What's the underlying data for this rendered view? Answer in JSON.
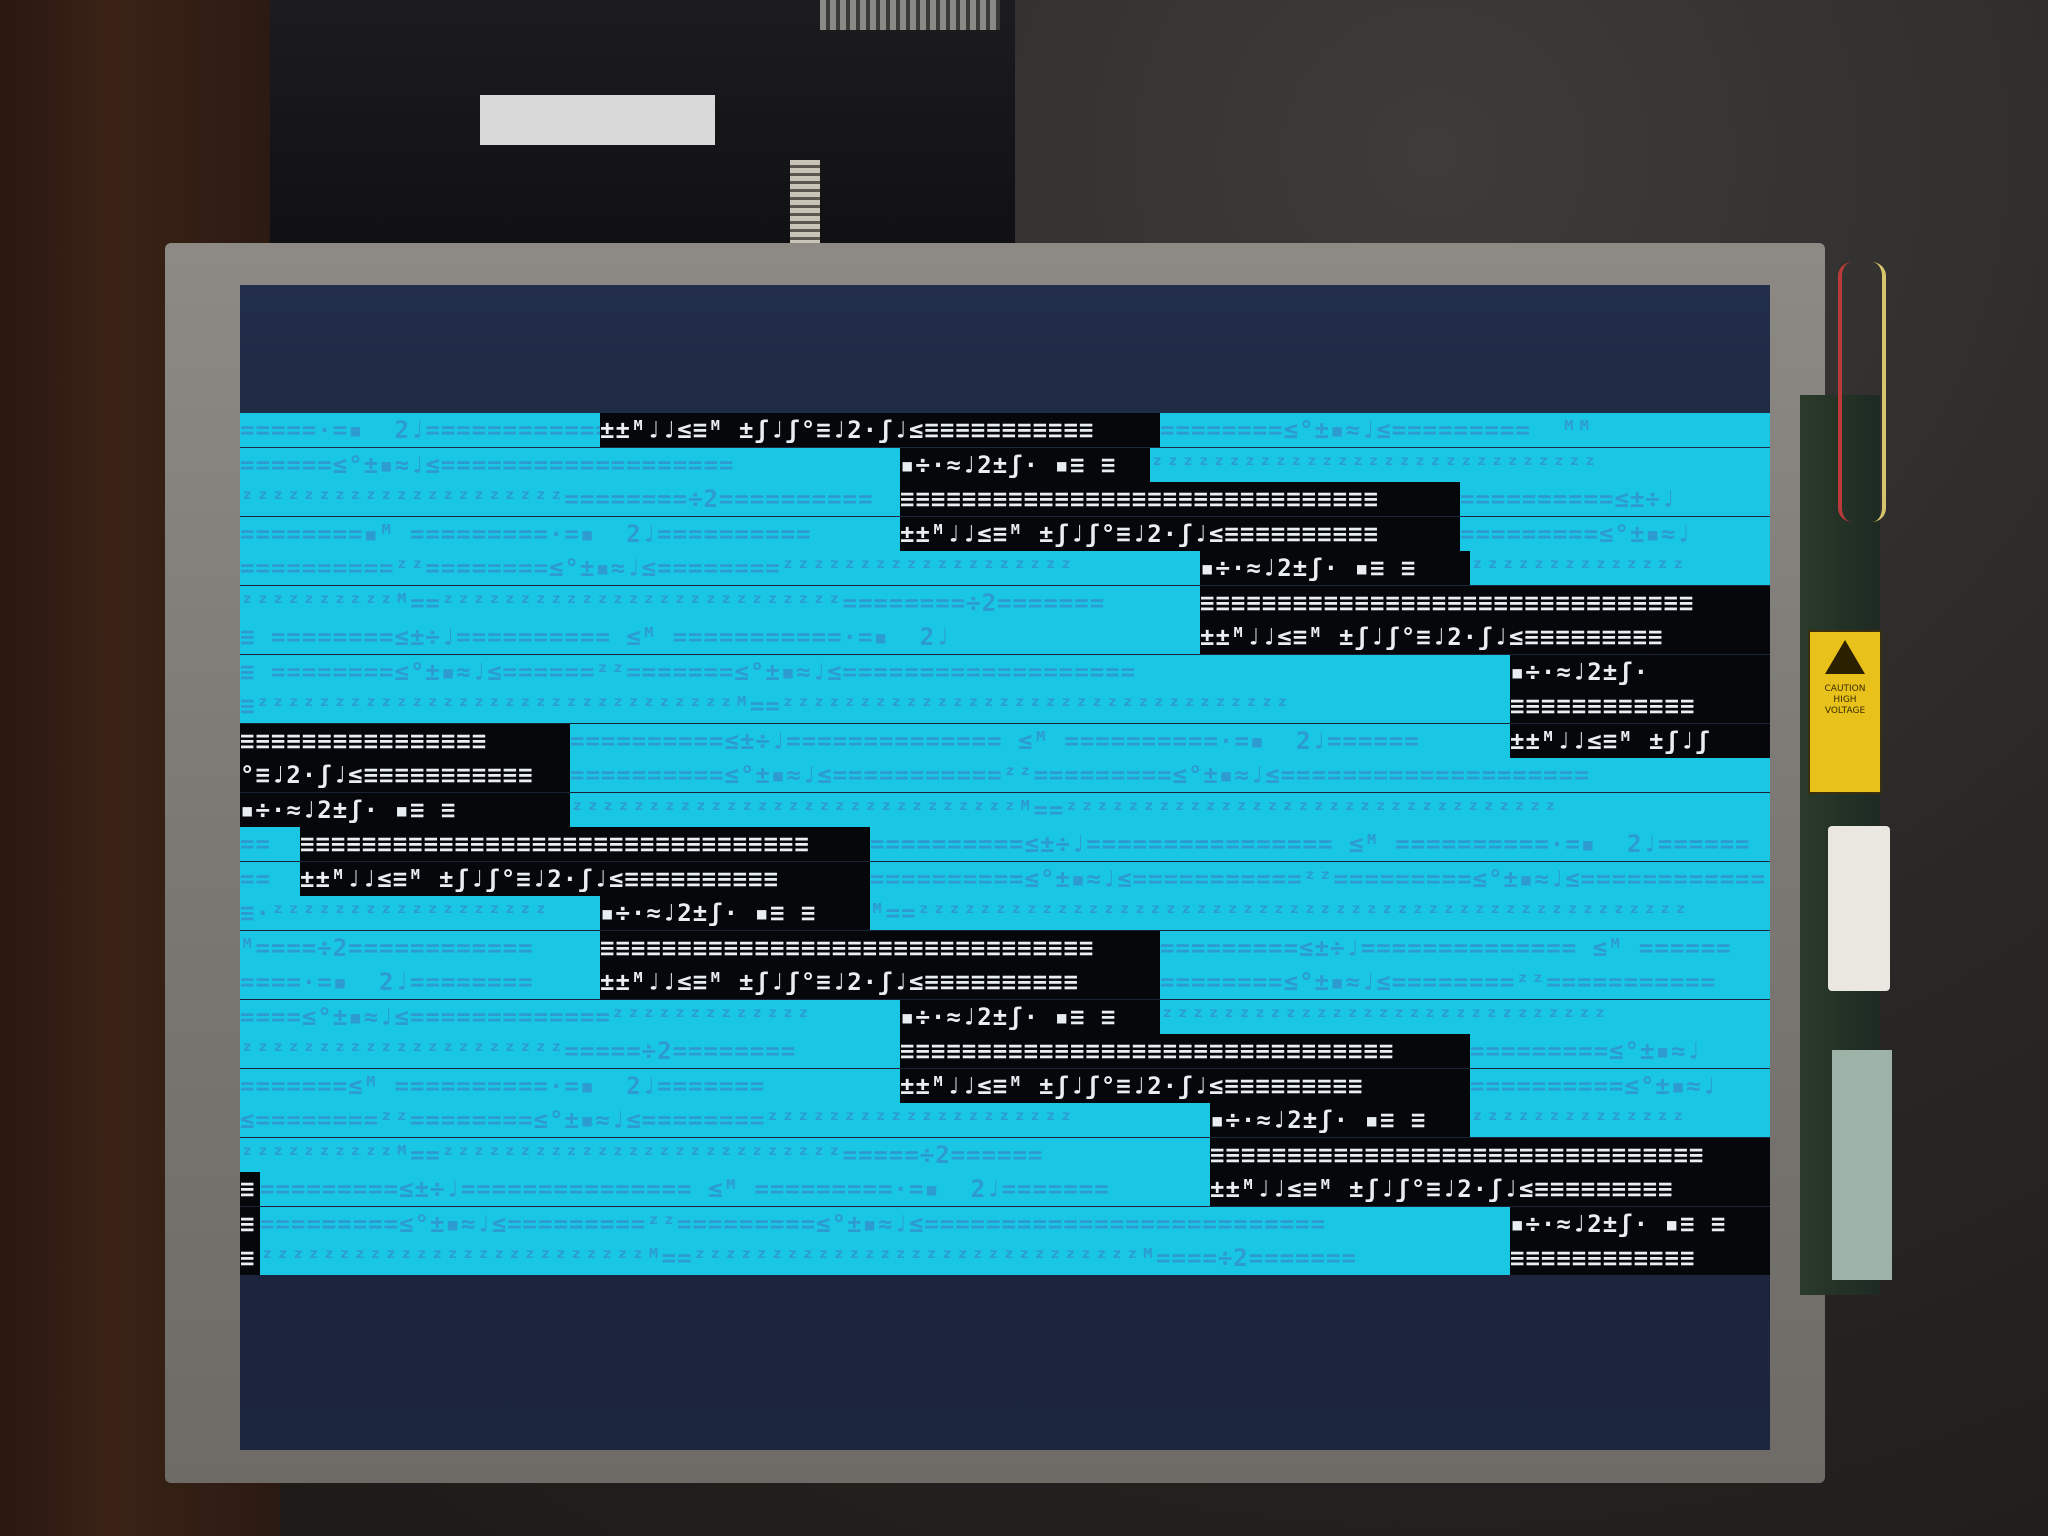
{
  "scene": {
    "colors": {
      "screen_off": "#1a2336",
      "cyan": "#19c6e4",
      "cyan_text": "#2d9ad0",
      "black_band": "#05070b",
      "black_text": "#e9eef2",
      "bezel": "#7b7873",
      "warning_label": "#e8c21a"
    },
    "warning_label": {
      "icon": "high-voltage-icon",
      "line1": "CAUTION",
      "line2": "HIGH",
      "line3": "VOLTAGE"
    }
  },
  "garbage_rows": [
    {
      "segs": [
        {
          "c": "cy",
          "w": 360,
          "t": "=====·=▪  2♩=================="
        },
        {
          "c": "bk",
          "w": 560,
          "t": "±±ᴹ♩♩≤≡ᴹ ±ʃ♩ʃ°≡♩2·ʃ♩≤≡≡≡≡≡≡≡≡≡≡≡"
        },
        {
          "c": "cy",
          "w": 610,
          "t": "========≤°±▪≈♩≤=========  ᴹᴹ"
        }
      ]
    },
    {
      "segs": [
        {
          "c": "cy",
          "w": 660,
          "t": "======≤°±▪≈♩≤==================="
        },
        {
          "c": "bk",
          "w": 250,
          "t": "▪÷·≈♩2±ʃ· ▪≡ ≡"
        },
        {
          "c": "cy",
          "w": 620,
          "t": "ᶻᶻᶻᶻᶻᶻᶻᶻᶻᶻᶻᶻᶻᶻᶻᶻᶻᶻᶻᶻᶻᶻᶻᶻᶻᶻᶻᶻᶻ"
        }
      ]
    },
    {
      "segs": [
        {
          "c": "cy",
          "w": 660,
          "t": "ᶻᶻᶻᶻᶻᶻᶻᶻᶻᶻᶻᶻᶻᶻᶻᶻᶻᶻᶻᶻᶻ========÷2=========="
        },
        {
          "c": "bk",
          "w": 560,
          "t": "≡≡≡≡≡≡≡≡≡≡≡≡≡≡≡≡≡≡≡≡≡≡≡≡≡≡≡≡≡≡≡"
        },
        {
          "c": "cy",
          "w": 310,
          "t": "==========≤±÷♩"
        }
      ]
    },
    {
      "segs": [
        {
          "c": "cy",
          "w": 660,
          "t": "========▪ᴹ =========·=▪  2♩=========="
        },
        {
          "c": "bk",
          "w": 560,
          "t": "±±ᴹ♩♩≤≡ᴹ ±ʃ♩ʃ°≡♩2·ʃ♩≤≡≡≡≡≡≡≡≡≡≡"
        },
        {
          "c": "cy",
          "w": 310,
          "t": "=========≤°±▪≈♩"
        }
      ]
    },
    {
      "segs": [
        {
          "c": "cy",
          "w": 960,
          "t": "==========ᶻᶻ========≤°±▪≈♩≤========ᶻᶻᶻᶻᶻᶻᶻᶻᶻᶻᶻᶻᶻᶻᶻᶻᶻᶻᶻ"
        },
        {
          "c": "bk",
          "w": 270,
          "t": "▪÷·≈♩2±ʃ· ▪≡ ≡"
        },
        {
          "c": "cy",
          "w": 300,
          "t": "ᶻᶻᶻᶻᶻᶻᶻᶻᶻᶻᶻᶻᶻᶻ"
        }
      ]
    },
    {
      "segs": [
        {
          "c": "cy",
          "w": 960,
          "t": "ᶻᶻᶻᶻᶻᶻᶻᶻᶻᶻᴹ==ᶻᶻᶻᶻᶻᶻᶻᶻᶻᶻᶻᶻᶻᶻᶻᶻᶻᶻᶻᶻᶻᶻᶻᶻᶻᶻ========÷2======="
        },
        {
          "c": "bk",
          "w": 570,
          "t": "≡≡≡≡≡≡≡≡≡≡≡≡≡≡≡≡≡≡≡≡≡≡≡≡≡≡≡≡≡≡≡≡"
        }
      ]
    },
    {
      "segs": [
        {
          "c": "cy",
          "w": 960,
          "t": "≡ ========≤±÷♩========== ≤ᴹ ===========·=▪  2♩"
        },
        {
          "c": "bk",
          "w": 570,
          "t": "±±ᴹ♩♩≤≡ᴹ ±ʃ♩ʃ°≡♩2·ʃ♩≤≡≡≡≡≡≡≡≡≡"
        }
      ]
    },
    {
      "segs": [
        {
          "c": "cy",
          "w": 1270,
          "t": "≡ ========≤°±▪≈♩≤======ᶻᶻ=======≤°±▪≈♩≤==================="
        },
        {
          "c": "bk",
          "w": 260,
          "t": "▪÷·≈♩2±ʃ·"
        }
      ]
    },
    {
      "segs": [
        {
          "c": "cy",
          "w": 1270,
          "t": "≡ᶻᶻᶻᶻᶻᶻᶻᶻᶻᶻᶻᶻᶻᶻᶻᶻᶻᶻᶻᶻᶻᶻᶻᶻᶻᶻᶻᶻᶻᶻᶻᴹ==ᶻᶻᶻᶻᶻᶻᶻᶻᶻᶻᶻᶻᶻᶻᶻᶻᶻᶻᶻᶻᶻᶻᶻᶻᶻᶻᶻᶻᶻᶻᶻᶻᶻ"
        },
        {
          "c": "bk",
          "w": 260,
          "t": "≡≡≡≡≡≡≡≡≡≡≡≡"
        }
      ]
    },
    {
      "segs": [
        {
          "c": "bk",
          "w": 330,
          "t": "≡≡≡≡≡≡≡≡≡≡≡≡≡≡≡≡"
        },
        {
          "c": "cy",
          "w": 940,
          "t": "==========≤±÷♩============== ≤ᴹ ==========·=▪  2♩======"
        },
        {
          "c": "bk",
          "w": 260,
          "t": "±±ᴹ♩♩≤≡ᴹ ±ʃ♩ʃ"
        }
      ]
    },
    {
      "segs": [
        {
          "c": "bk",
          "w": 330,
          "t": "°≡♩2·ʃ♩≤≡≡≡≡≡≡≡≡≡≡≡"
        },
        {
          "c": "cy",
          "w": 1200,
          "t": "==========≤°±▪≈♩≤===========ᶻᶻ=========≤°±▪≈♩≤===================="
        }
      ]
    },
    {
      "segs": [
        {
          "c": "bk",
          "w": 330,
          "t": "▪÷·≈♩2±ʃ· ▪≡ ≡"
        },
        {
          "c": "cy",
          "w": 1200,
          "t": "ᶻᶻᶻᶻᶻᶻᶻᶻᶻᶻᶻᶻᶻᶻᶻᶻᶻᶻᶻᶻᶻᶻᶻᶻᶻᶻᶻᶻᶻᴹ==ᶻᶻᶻᶻᶻᶻᶻᶻᶻᶻᶻᶻᶻᶻᶻᶻᶻᶻᶻᶻᶻᶻᶻᶻᶻᶻᶻᶻᶻᶻᶻᶻ"
        }
      ]
    },
    {
      "segs": [
        {
          "c": "cy",
          "w": 60,
          "t": "=="
        },
        {
          "c": "bk",
          "w": 570,
          "t": "≡≡≡≡≡≡≡≡≡≡≡≡≡≡≡≡≡≡≡≡≡≡≡≡≡≡≡≡≡≡≡≡≡"
        },
        {
          "c": "cy",
          "w": 900,
          "t": "==========≤±÷♩================ ≤ᴹ ==========·=▪  2♩======"
        }
      ]
    },
    {
      "segs": [
        {
          "c": "cy",
          "w": 60,
          "t": "=="
        },
        {
          "c": "bk",
          "w": 570,
          "t": "±±ᴹ♩♩≤≡ᴹ ±ʃ♩ʃ°≡♩2·ʃ♩≤≡≡≡≡≡≡≡≡≡≡"
        },
        {
          "c": "cy",
          "w": 900,
          "t": "==========≤°±▪≈♩≤===========ᶻᶻ=========≤°±▪≈♩≤============"
        }
      ]
    },
    {
      "segs": [
        {
          "c": "cy",
          "w": 360,
          "t": "≡·ᶻᶻᶻᶻᶻᶻᶻᶻᶻᶻᶻᶻᶻᶻᶻᶻᶻᶻ"
        },
        {
          "c": "bk",
          "w": 270,
          "t": "▪÷·≈♩2±ʃ· ▪≡ ≡"
        },
        {
          "c": "cy",
          "w": 900,
          "t": "ᴹ==ᶻᶻᶻᶻᶻᶻᶻᶻᶻᶻᶻᶻᶻᶻᶻᶻᶻᶻᶻᶻᶻᶻᶻᶻᶻᶻᶻᶻᶻᶻᶻᶻᶻᶻᶻᶻᶻᶻᶻᶻᶻᶻᶻᶻᶻᶻᶻᶻᶻᶻ"
        }
      ]
    },
    {
      "segs": [
        {
          "c": "cy",
          "w": 360,
          "t": "ᴹ====÷2============"
        },
        {
          "c": "bk",
          "w": 560,
          "t": "≡≡≡≡≡≡≡≡≡≡≡≡≡≡≡≡≡≡≡≡≡≡≡≡≡≡≡≡≡≡≡≡"
        },
        {
          "c": "cy",
          "w": 610,
          "t": "=========≤±÷♩============== ≤ᴹ ======"
        }
      ]
    },
    {
      "segs": [
        {
          "c": "cy",
          "w": 360,
          "t": "====·=▪  2♩========"
        },
        {
          "c": "bk",
          "w": 560,
          "t": "±±ᴹ♩♩≤≡ᴹ ±ʃ♩ʃ°≡♩2·ʃ♩≤≡≡≡≡≡≡≡≡≡≡"
        },
        {
          "c": "cy",
          "w": 610,
          "t": "========≤°±▪≈♩≤========ᶻᶻ==========="
        }
      ]
    },
    {
      "segs": [
        {
          "c": "cy",
          "w": 660,
          "t": "====≤°±▪≈♩≤=============ᶻᶻᶻᶻᶻᶻᶻᶻᶻᶻᶻᶻᶻ"
        },
        {
          "c": "bk",
          "w": 260,
          "t": "▪÷·≈♩2±ʃ· ▪≡ ≡"
        },
        {
          "c": "cy",
          "w": 610,
          "t": "ᶻᶻᶻᶻᶻᶻᶻᶻᶻᶻᶻᶻᶻᶻᶻᶻᶻᶻᶻᶻᶻᶻᶻᶻᶻᶻᶻᶻᶻ"
        }
      ]
    },
    {
      "segs": [
        {
          "c": "cy",
          "w": 660,
          "t": "ᶻᶻᶻᶻᶻᶻᶻᶻᶻᶻᶻᶻᶻᶻᶻᶻᶻᶻᶻᶻᶻ=====÷2========"
        },
        {
          "c": "bk",
          "w": 570,
          "t": "≡≡≡≡≡≡≡≡≡≡≡≡≡≡≡≡≡≡≡≡≡≡≡≡≡≡≡≡≡≡≡≡"
        },
        {
          "c": "cy",
          "w": 300,
          "t": "=========≤°±▪≈♩"
        }
      ]
    },
    {
      "segs": [
        {
          "c": "cy",
          "w": 660,
          "t": "=======≤ᴹ ==========·=▪  2♩======="
        },
        {
          "c": "bk",
          "w": 570,
          "t": "±±ᴹ♩♩≤≡ᴹ ±ʃ♩ʃ°≡♩2·ʃ♩≤≡≡≡≡≡≡≡≡≡"
        },
        {
          "c": "cy",
          "w": 300,
          "t": "==========≤°±▪≈♩"
        }
      ]
    },
    {
      "segs": [
        {
          "c": "cy",
          "w": 970,
          "t": "≤========ᶻᶻ========≤°±▪≈♩≤========ᶻᶻᶻᶻᶻᶻᶻᶻᶻᶻᶻᶻᶻᶻᶻᶻᶻᶻᶻᶻ"
        },
        {
          "c": "bk",
          "w": 260,
          "t": "▪÷·≈♩2±ʃ· ▪≡ ≡"
        },
        {
          "c": "cy",
          "w": 300,
          "t": "ᶻᶻᶻᶻᶻᶻᶻᶻᶻᶻᶻᶻᶻᶻ"
        }
      ]
    },
    {
      "segs": [
        {
          "c": "cy",
          "w": 970,
          "t": "ᶻᶻᶻᶻᶻᶻᶻᶻᶻᶻᴹ==ᶻᶻᶻᶻᶻᶻᶻᶻᶻᶻᶻᶻᶻᶻᶻᶻᶻᶻᶻᶻᶻᶻᶻᶻᶻᶻ=====÷2======"
        },
        {
          "c": "bk",
          "w": 560,
          "t": "≡≡≡≡≡≡≡≡≡≡≡≡≡≡≡≡≡≡≡≡≡≡≡≡≡≡≡≡≡≡≡≡"
        }
      ]
    },
    {
      "segs": [
        {
          "c": "bk",
          "w": 20,
          "t": "≡"
        },
        {
          "c": "cy",
          "w": 950,
          "t": "=========≤±÷♩=============== ≤ᴹ =========·=▪  2♩======="
        },
        {
          "c": "bk",
          "w": 560,
          "t": "±±ᴹ♩♩≤≡ᴹ ±ʃ♩ʃ°≡♩2·ʃ♩≤≡≡≡≡≡≡≡≡≡"
        }
      ]
    },
    {
      "segs": [
        {
          "c": "bk",
          "w": 20,
          "t": "≡"
        },
        {
          "c": "cy",
          "w": 1250,
          "t": "=========≤°±▪≈♩≤=========ᶻᶻ=========≤°±▪≈♩≤=========================="
        },
        {
          "c": "bk",
          "w": 260,
          "t": "▪÷·≈♩2±ʃ· ▪≡ ≡"
        }
      ]
    },
    {
      "segs": [
        {
          "c": "bk",
          "w": 20,
          "t": "≡"
        },
        {
          "c": "cy",
          "w": 1250,
          "t": "ᶻᶻᶻᶻᶻᶻᶻᶻᶻᶻᶻᶻᶻᶻᶻᶻᶻᶻᶻᶻᶻᶻᶻᶻᶻᴹ==ᶻᶻᶻᶻᶻᶻᶻᶻᶻᶻᶻᶻᶻᶻᶻᶻᶻᶻᶻᶻᶻᶻᶻᶻᶻᶻᶻᶻᶻᴹ====÷2======="
        },
        {
          "c": "bk",
          "w": 260,
          "t": "≡≡≡≡≡≡≡≡≡≡≡≡"
        }
      ]
    }
  ]
}
